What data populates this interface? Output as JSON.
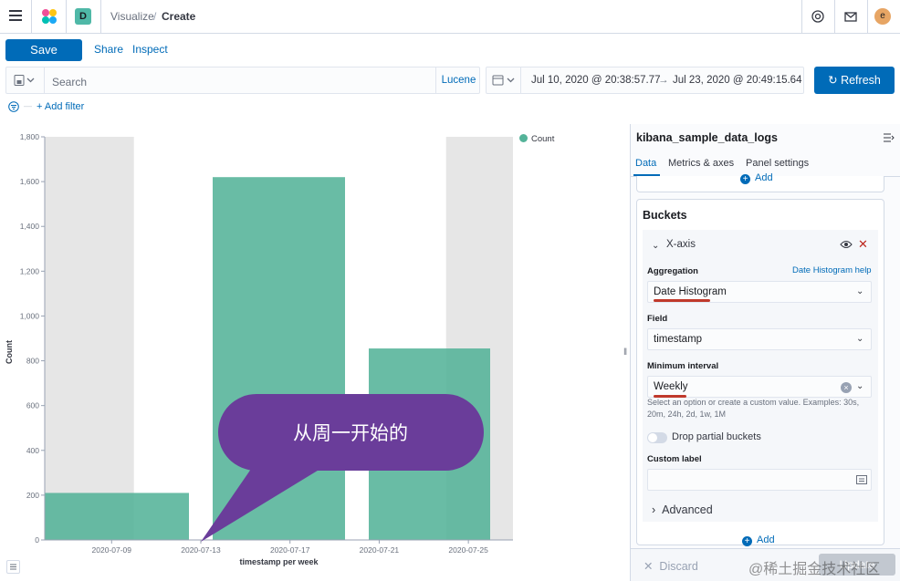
{
  "header": {
    "space_badge": "D",
    "breadcrumb": [
      "Visualize",
      "Create"
    ],
    "breadcrumb_sep": "/",
    "avatar": "e"
  },
  "topnav": {
    "save": "Save",
    "share": "Share",
    "inspect": "Inspect"
  },
  "querybar": {
    "placeholder": "Search",
    "language": "Lucene"
  },
  "datepicker": {
    "start": "Jul 10, 2020 @ 20:38:57.77",
    "arrow": "→",
    "end": "Jul 23, 2020 @ 20:49:15.64"
  },
  "refresh": "Refresh",
  "filters": {
    "add": "+ Add filter",
    "dash": "—"
  },
  "chart_data": {
    "type": "bar",
    "xlabel": "timestamp per week",
    "ylabel": "Count",
    "ylim": [
      0,
      1800
    ],
    "yticks": [
      "0",
      "200",
      "400",
      "600",
      "800",
      "1,000",
      "1,200",
      "1,400",
      "1,600",
      "1,800"
    ],
    "tick_labels": [
      "2020-07-09",
      "2020-07-13",
      "2020-07-17",
      "2020-07-21",
      "2020-07-25"
    ],
    "series": [
      {
        "name": "Count",
        "color": "#54b399"
      }
    ],
    "bars": [
      {
        "start": "2020-07-06",
        "end": "2020-07-13",
        "value": 210
      },
      {
        "start": "2020-07-13",
        "end": "2020-07-20",
        "value": 1620
      },
      {
        "start": "2020-07-20",
        "end": "2020-07-27",
        "value": 855
      }
    ],
    "out_of_range_shading": [
      {
        "from": "2020-07-06",
        "to": "2020-07-10"
      },
      {
        "from": "2020-07-24",
        "to": "2020-07-27"
      }
    ],
    "legend": "top-right",
    "annotation": "从周一开始的"
  },
  "sidebar": {
    "index": "kibana_sample_data_logs",
    "tabs": [
      "Data",
      "Metrics & axes",
      "Panel settings"
    ],
    "add": "Add",
    "buckets_title": "Buckets",
    "x_axis": "X-axis",
    "aggregation_label": "Aggregation",
    "help_link": "Date Histogram help",
    "aggregation_value": "Date Histogram",
    "field_label": "Field",
    "field_value": "timestamp",
    "interval_label": "Minimum interval",
    "interval_value": "Weekly",
    "interval_hint": "Select an option or create a custom value. Examples: 30s, 20m, 24h, 2d, 1w, 1M",
    "drop_partial": "Drop partial buckets",
    "custom_label": "Custom label",
    "advanced": "Advanced",
    "discard": "Discard",
    "apply": "Update"
  },
  "watermark": "@稀土掘金技术社区",
  "colors": {
    "accent": "#006bb8",
    "bar": "#54b399",
    "callout": "#6a3d9a"
  }
}
